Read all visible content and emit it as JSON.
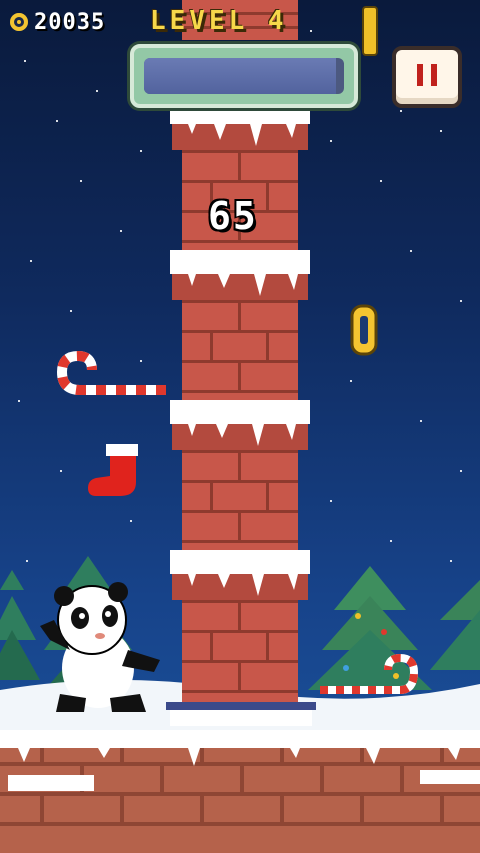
{
  "hud": {
    "coins": "20035",
    "level": "LEVEL 4",
    "pause_icon": "pause-icon"
  },
  "progress": {
    "value_percent": 96
  },
  "score": "65",
  "colors": {
    "sky_top": "#0a1a3c",
    "sky_bottom": "#1c56a0",
    "brick": "#c8574a",
    "snow": "#ffffff",
    "gold": "#f4c531",
    "pause_red": "#c0221d"
  },
  "icons": [
    "coin-icon",
    "pause-icon",
    "panda-character",
    "candy-cane",
    "stocking",
    "christmas-tree",
    "gold-coin"
  ]
}
